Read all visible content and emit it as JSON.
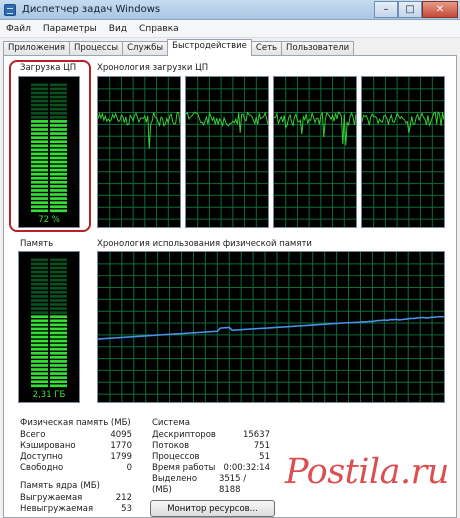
{
  "window": {
    "title": "Диспетчер задач Windows"
  },
  "window_buttons": {
    "minimize": "–",
    "maximize": "□",
    "close": "✕"
  },
  "menu": [
    "Файл",
    "Параметры",
    "Вид",
    "Справка"
  ],
  "tabs": [
    {
      "label": "Приложения",
      "active": false
    },
    {
      "label": "Процессы",
      "active": false
    },
    {
      "label": "Службы",
      "active": false
    },
    {
      "label": "Быстродействие",
      "active": true
    },
    {
      "label": "Сеть",
      "active": false
    },
    {
      "label": "Пользователи",
      "active": false
    }
  ],
  "cpu": {
    "title": "Загрузка ЦП",
    "value_label": "72 %",
    "level": 0.72
  },
  "cpu_history": {
    "title": "Хронология загрузки ЦП",
    "cores": 4
  },
  "memory": {
    "title": "Память",
    "value_label": "2,31 ГБ",
    "level": 0.57
  },
  "memory_history": {
    "title": "Хронология использования физической памяти",
    "level_start": 0.42,
    "level_end": 0.57
  },
  "physical_memory": {
    "title": "Физическая память (МБ)",
    "rows": [
      {
        "label": "Всего",
        "value": "4095"
      },
      {
        "label": "Кэшировано",
        "value": "1770"
      },
      {
        "label": "Доступно",
        "value": "1799"
      },
      {
        "label": "Свободно",
        "value": "0"
      }
    ]
  },
  "kernel_memory": {
    "title": "Память ядра (МБ)",
    "rows": [
      {
        "label": "Выгружаемая",
        "value": "212"
      },
      {
        "label": "Невыгружаемая",
        "value": "53"
      }
    ]
  },
  "system": {
    "title": "Система",
    "rows": [
      {
        "label": "Дескрипторов",
        "value": "15637"
      },
      {
        "label": "Потоков",
        "value": "751"
      },
      {
        "label": "Процессов",
        "value": "51"
      },
      {
        "label": "Время работы",
        "value": "0:00:32:14"
      },
      {
        "label": "Выделено (МБ)",
        "value": "3515 / 8188"
      }
    ]
  },
  "buttons": {
    "resource_monitor": "Монитор ресурсов..."
  },
  "watermark": {
    "text": "Postila.ru"
  },
  "colors": {
    "graph_line": "#37d037",
    "memory_line": "#4a90e8",
    "grid": "#0d6e3a",
    "highlight": "#b8202b"
  }
}
